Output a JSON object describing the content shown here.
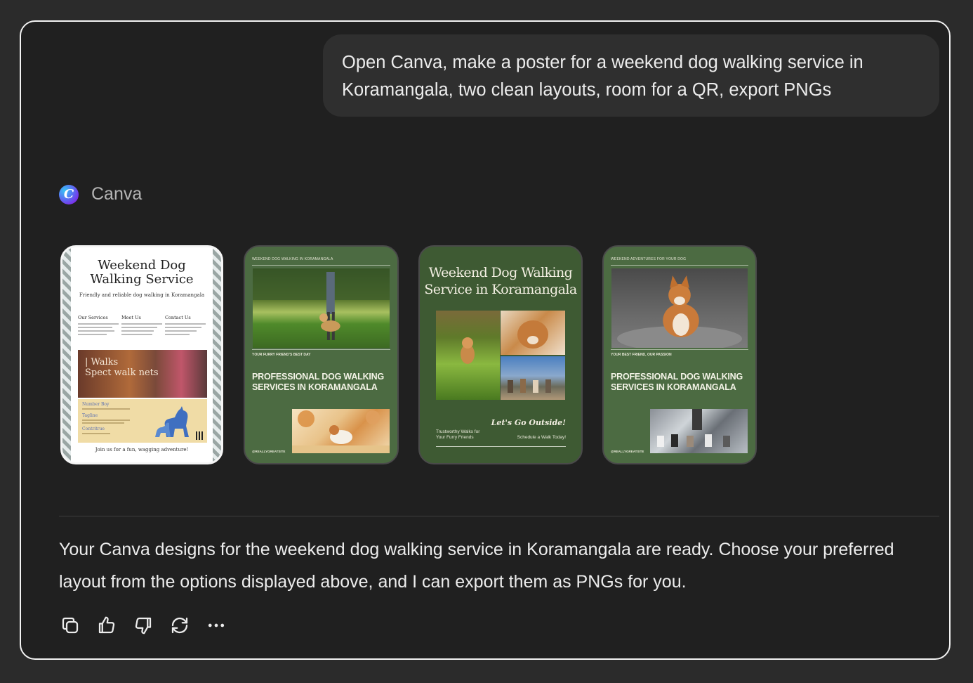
{
  "user_message": "Open Canva, make a poster for a weekend dog walking service in Koramangala, two clean layouts, room for a QR, export PNGs",
  "tool": {
    "name": "Canva",
    "logo_letter": "C"
  },
  "designs": [
    {
      "title": "Weekend Dog Walking Service",
      "subtitle": "Friendly and reliable dog walking in Koramangala",
      "columns": [
        "Our Services",
        "Meet Us",
        "Contact Us"
      ],
      "photo_text": "| Walks\nSpect walk nets",
      "beige_labels": [
        "Number Boy",
        "Tagline",
        "Contritrue"
      ],
      "footer": "Join us for a fun, wagging adventure!"
    },
    {
      "top_label": "WEEKEND DOG WALKING IN KORAMANGALA",
      "small_label": "YOUR FURRY FRIEND'S BEST DAY",
      "headline": "PROFESSIONAL DOG WALKING SERVICES IN KORAMANGALA",
      "handle": "@REALLYGREATSITE"
    },
    {
      "title": "Weekend Dog Walking Service in Koramangala",
      "script": "Let's Go Outside!",
      "left_text": "Trustworthy Walks for\nYour Furry Friends",
      "right_text": "Schedule a Walk Today!"
    },
    {
      "top_label": "WEEKEND ADVENTURES FOR YOUR DOG",
      "small_label": "YOUR BEST FRIEND, OUR PASSION",
      "headline": "PROFESSIONAL DOG WALKING SERVICES IN KORAMANGALA",
      "handle": "@REALLYGREATSITE"
    }
  ],
  "assistant_message": "Your Canva designs for the weekend dog walking service in Koramangala are ready. Choose your preferred layout from the options displayed above, and I can export them as PNGs for you.",
  "actions": [
    {
      "name": "copy-button",
      "icon": "copy-icon"
    },
    {
      "name": "thumbs-up-button",
      "icon": "thumbs-up-icon"
    },
    {
      "name": "thumbs-down-button",
      "icon": "thumbs-down-icon"
    },
    {
      "name": "regenerate-button",
      "icon": "regenerate-icon"
    },
    {
      "name": "more-options-button",
      "icon": "more-icon"
    }
  ],
  "colors": {
    "background": "#202020",
    "bubble": "#2f2f2f",
    "text": "#ececec",
    "muted": "#b4b4b4",
    "green_card": "#4c6b42"
  }
}
